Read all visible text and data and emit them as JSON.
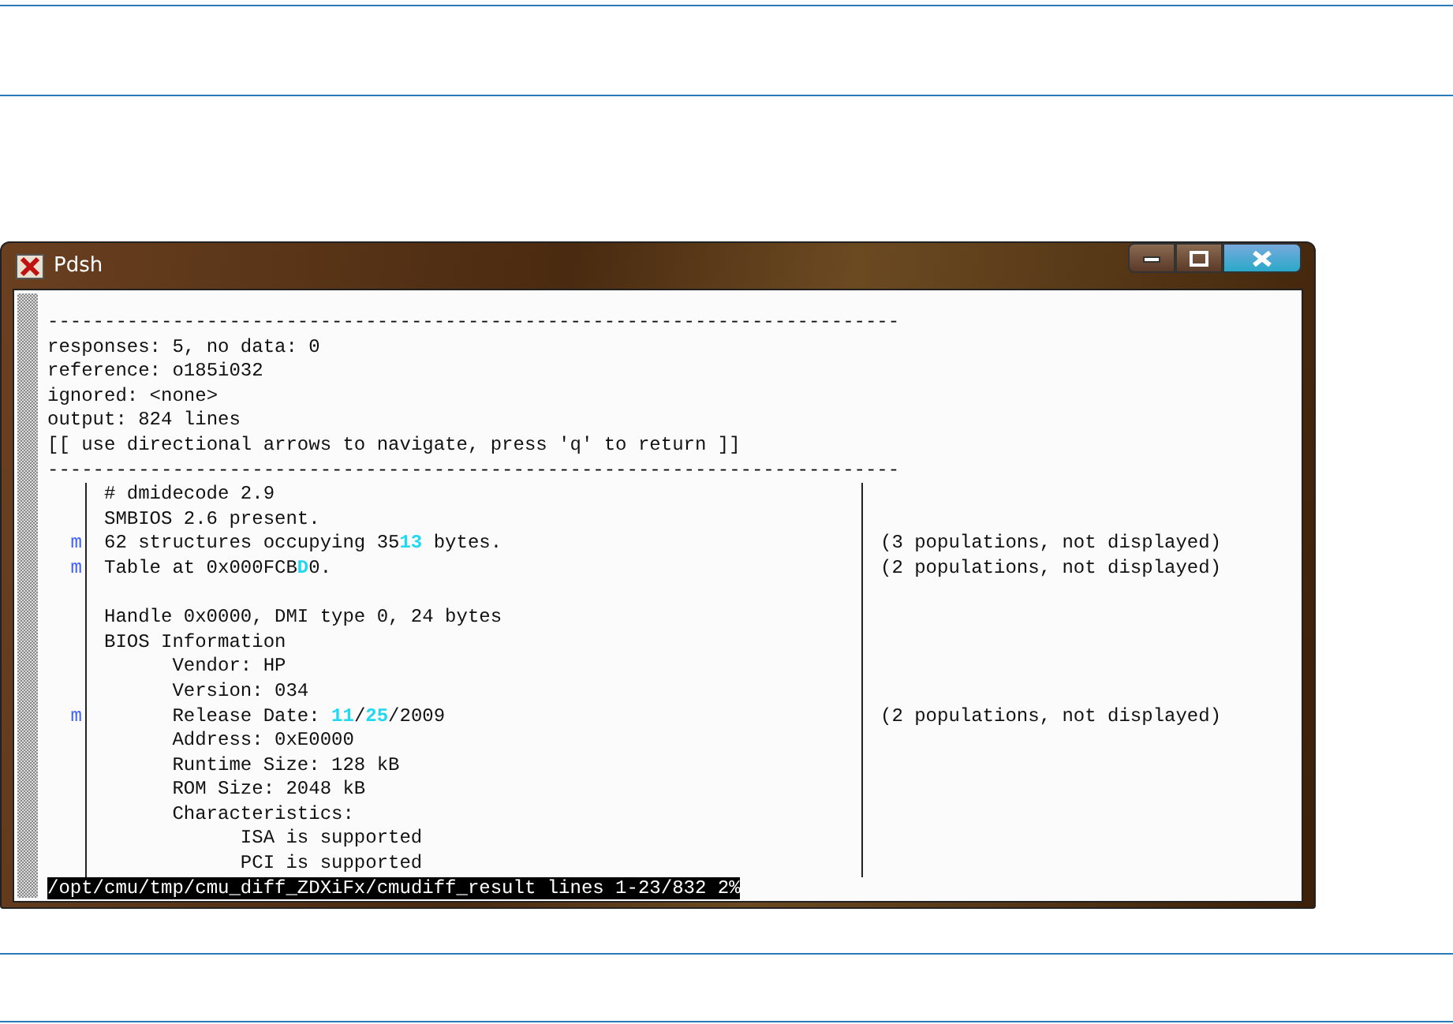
{
  "window": {
    "title": "Pdsh"
  },
  "header_lines": [
    "---------------------------------------------------------------------------",
    "responses: 5, no data: 0",
    "reference: o185i032",
    "ignored: <none>",
    "output: 824 lines",
    "[[ use directional arrows to navigate, press 'q' to return ]]",
    "---------------------------------------------------------------------------"
  ],
  "diff_rows": [
    {
      "marker": "",
      "segments": [
        {
          "text": "# dmidecode 2.9",
          "highlight": false
        }
      ],
      "note": ""
    },
    {
      "marker": "",
      "segments": [
        {
          "text": "SMBIOS 2.6 present.",
          "highlight": false
        }
      ],
      "note": ""
    },
    {
      "marker": "m",
      "segments": [
        {
          "text": "62 structures occupying 35",
          "highlight": false
        },
        {
          "text": "13",
          "highlight": true
        },
        {
          "text": " bytes.",
          "highlight": false
        }
      ],
      "note": "(3 populations, not displayed)"
    },
    {
      "marker": "m",
      "segments": [
        {
          "text": "Table at 0x000FCB",
          "highlight": false
        },
        {
          "text": "D",
          "highlight": true
        },
        {
          "text": "0.",
          "highlight": false
        }
      ],
      "note": "(2 populations, not displayed)"
    },
    {
      "marker": "",
      "segments": [],
      "note": ""
    },
    {
      "marker": "",
      "segments": [
        {
          "text": "Handle 0x0000, DMI type 0, 24 bytes",
          "highlight": false
        }
      ],
      "note": ""
    },
    {
      "marker": "",
      "segments": [
        {
          "text": "BIOS Information",
          "highlight": false
        }
      ],
      "note": ""
    },
    {
      "marker": "",
      "segments": [
        {
          "text": "      Vendor: HP",
          "highlight": false
        }
      ],
      "note": ""
    },
    {
      "marker": "",
      "segments": [
        {
          "text": "      Version: 034",
          "highlight": false
        }
      ],
      "note": ""
    },
    {
      "marker": "m",
      "segments": [
        {
          "text": "      Release Date: ",
          "highlight": false
        },
        {
          "text": "11",
          "highlight": true
        },
        {
          "text": "/",
          "highlight": false
        },
        {
          "text": "25",
          "highlight": true
        },
        {
          "text": "/2009",
          "highlight": false
        }
      ],
      "note": "(2 populations, not displayed)"
    },
    {
      "marker": "",
      "segments": [
        {
          "text": "      Address: 0xE0000",
          "highlight": false
        }
      ],
      "note": ""
    },
    {
      "marker": "",
      "segments": [
        {
          "text": "      Runtime Size: 128 kB",
          "highlight": false
        }
      ],
      "note": ""
    },
    {
      "marker": "",
      "segments": [
        {
          "text": "      ROM Size: 2048 kB",
          "highlight": false
        }
      ],
      "note": ""
    },
    {
      "marker": "",
      "segments": [
        {
          "text": "      Characteristics:",
          "highlight": false
        }
      ],
      "note": ""
    },
    {
      "marker": "",
      "segments": [
        {
          "text": "            ISA is supported",
          "highlight": false
        }
      ],
      "note": ""
    },
    {
      "marker": "",
      "segments": [
        {
          "text": "            PCI is supported",
          "highlight": false
        }
      ],
      "note": ""
    }
  ],
  "status_line": "/opt/cmu/tmp/cmu_diff_ZDXiFx/cmudiff_result lines 1-23/832 2%"
}
